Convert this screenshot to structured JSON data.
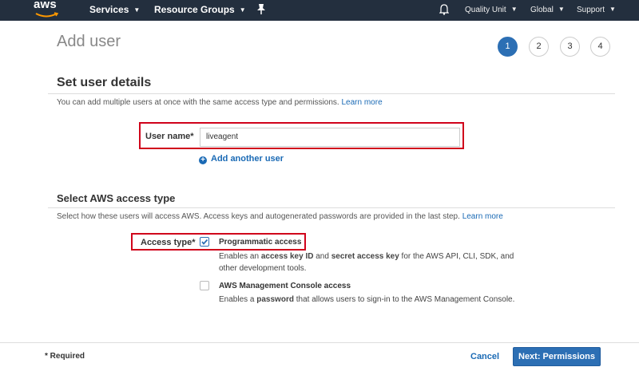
{
  "nav": {
    "logo": "aws",
    "services": "Services",
    "resource_groups": "Resource Groups",
    "account": "Quality Unit",
    "region": "Global",
    "support": "Support"
  },
  "page": {
    "title": "Add user",
    "steps": [
      "1",
      "2",
      "3",
      "4"
    ],
    "active_step": 1
  },
  "user_details": {
    "title": "Set user details",
    "description": "You can add multiple users at once with the same access type and permissions.",
    "learn_more": "Learn more",
    "user_name_label": "User name*",
    "user_name_value": "liveagent",
    "add_another_user": "Add another user"
  },
  "access_type": {
    "title": "Select AWS access type",
    "description": "Select how these users will access AWS. Access keys and autogenerated passwords are provided in the last step.",
    "learn_more": "Learn more",
    "label": "Access type*",
    "programmatic": {
      "title": "Programmatic access",
      "checked": true,
      "desc_1": "Enables an ",
      "desc_bold_1": "access key ID",
      "desc_2": " and ",
      "desc_bold_2": "secret access key",
      "desc_3": " for the AWS API, CLI, SDK, and other development tools."
    },
    "console": {
      "title": "AWS Management Console access",
      "checked": false,
      "desc_1": "Enables a ",
      "desc_bold_1": "password",
      "desc_2": " that allows users to sign-in to the AWS Management Console."
    }
  },
  "footer": {
    "required_note": "* Required",
    "cancel": "Cancel",
    "next": "Next: Permissions"
  },
  "colors": {
    "nav_bg": "#232f3e",
    "primary": "#2c6fb4",
    "highlight": "#d0021b",
    "link": "#1a6ab5"
  }
}
